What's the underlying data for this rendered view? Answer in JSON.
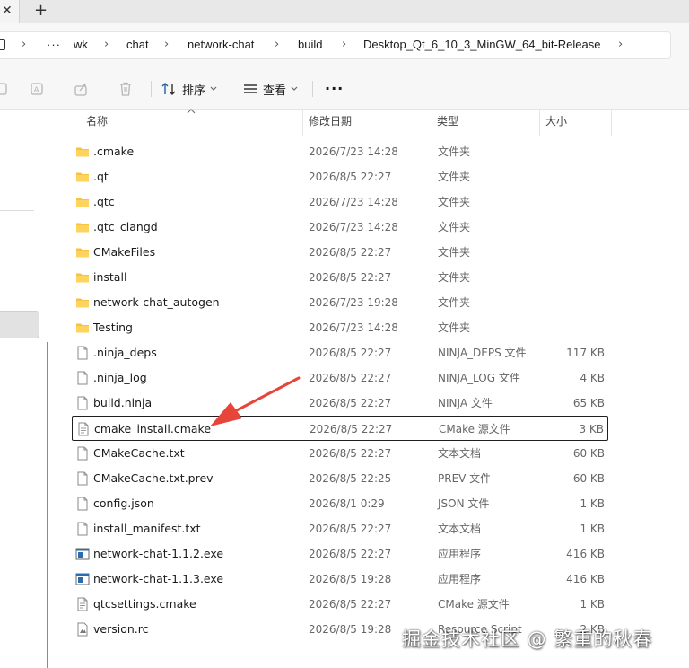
{
  "tabs": {
    "close_glyph": "✕",
    "new_tab_glyph": "+"
  },
  "address": {
    "overflow": "···",
    "crumbs": [
      "wk",
      "chat",
      "network-chat",
      "build",
      "Desktop_Qt_6_10_3_MinGW_64_bit-Release"
    ],
    "separator": "›"
  },
  "commandbar": {
    "sort_label": "排序",
    "view_label": "查看",
    "more_glyph": "···",
    "icons": [
      "cut-icon",
      "rename-icon",
      "share-icon",
      "delete-icon"
    ]
  },
  "columns": {
    "name": "名称",
    "date": "修改日期",
    "type": "类型",
    "size": "大小"
  },
  "files": [
    {
      "name": ".cmake",
      "date": "2026/7/23 14:28",
      "type": "文件夹",
      "size": "",
      "icon": "folder-icon"
    },
    {
      "name": ".qt",
      "date": "2026/8/5 22:27",
      "type": "文件夹",
      "size": "",
      "icon": "folder-icon"
    },
    {
      "name": ".qtc",
      "date": "2026/7/23 14:28",
      "type": "文件夹",
      "size": "",
      "icon": "folder-icon"
    },
    {
      "name": ".qtc_clangd",
      "date": "2026/7/23 14:28",
      "type": "文件夹",
      "size": "",
      "icon": "folder-icon"
    },
    {
      "name": "CMakeFiles",
      "date": "2026/8/5 22:27",
      "type": "文件夹",
      "size": "",
      "icon": "folder-icon"
    },
    {
      "name": "install",
      "date": "2026/8/5 22:27",
      "type": "文件夹",
      "size": "",
      "icon": "folder-icon"
    },
    {
      "name": "network-chat_autogen",
      "date": "2026/7/23 19:28",
      "type": "文件夹",
      "size": "",
      "icon": "folder-icon"
    },
    {
      "name": "Testing",
      "date": "2026/7/23 14:28",
      "type": "文件夹",
      "size": "",
      "icon": "folder-icon"
    },
    {
      "name": ".ninja_deps",
      "date": "2026/8/5 22:27",
      "type": "NINJA_DEPS 文件",
      "size": "117 KB",
      "icon": "file-icon"
    },
    {
      "name": ".ninja_log",
      "date": "2026/8/5 22:27",
      "type": "NINJA_LOG 文件",
      "size": "4 KB",
      "icon": "file-icon"
    },
    {
      "name": "build.ninja",
      "date": "2026/8/5 22:27",
      "type": "NINJA 文件",
      "size": "65 KB",
      "icon": "file-icon"
    },
    {
      "name": "cmake_install.cmake",
      "date": "2026/8/5 22:27",
      "type": "CMake 源文件",
      "size": "3 KB",
      "icon": "text-file-icon"
    },
    {
      "name": "CMakeCache.txt",
      "date": "2026/8/5 22:27",
      "type": "文本文档",
      "size": "60 KB",
      "icon": "file-icon"
    },
    {
      "name": "CMakeCache.txt.prev",
      "date": "2026/8/5 22:25",
      "type": "PREV 文件",
      "size": "60 KB",
      "icon": "file-icon"
    },
    {
      "name": "config.json",
      "date": "2026/8/1 0:29",
      "type": "JSON 文件",
      "size": "1 KB",
      "icon": "file-icon"
    },
    {
      "name": "install_manifest.txt",
      "date": "2026/8/5 22:27",
      "type": "文本文档",
      "size": "1 KB",
      "icon": "file-icon"
    },
    {
      "name": "network-chat-1.1.2.exe",
      "date": "2026/8/5 22:27",
      "type": "应用程序",
      "size": "416 KB",
      "icon": "exe-icon"
    },
    {
      "name": "network-chat-1.1.3.exe",
      "date": "2026/8/5 19:28",
      "type": "应用程序",
      "size": "416 KB",
      "icon": "exe-icon"
    },
    {
      "name": "qtcsettings.cmake",
      "date": "2026/8/5 22:27",
      "type": "CMake 源文件",
      "size": "1 KB",
      "icon": "text-file-icon"
    },
    {
      "name": "version.rc",
      "date": "2026/8/5 19:28",
      "type": "Resource Script",
      "size": "2 KB",
      "icon": "rc-file-icon"
    }
  ],
  "highlighted_file": "cmake_install.cmake",
  "watermark": "掘金技术社区 @ 繁重的秋春",
  "colors": {
    "folder": "#f5c242",
    "arrow": "#e8443a",
    "exe": "#2b6cb0"
  }
}
